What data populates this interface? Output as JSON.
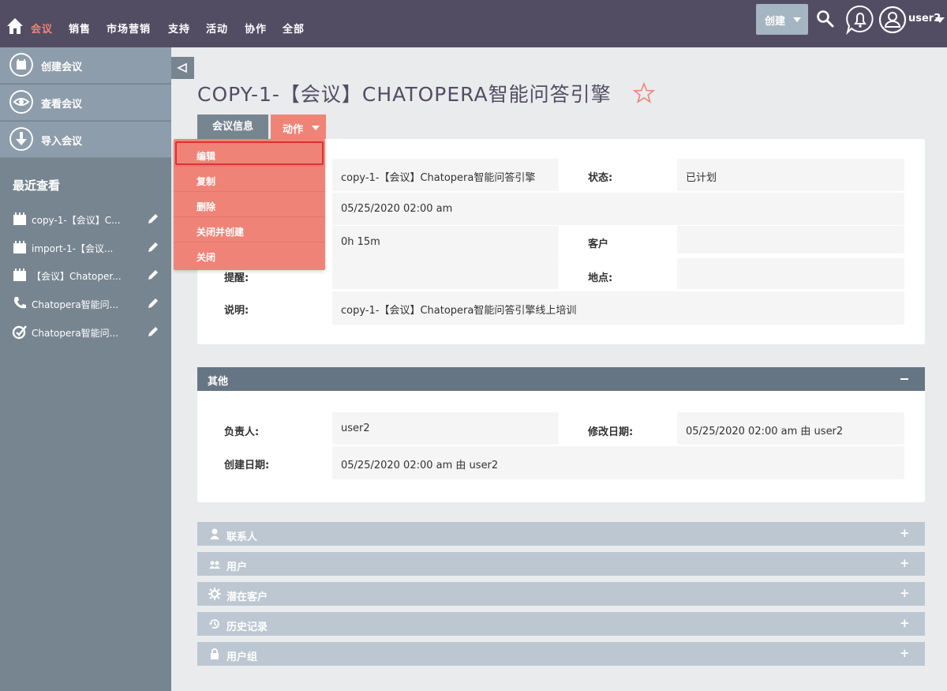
{
  "nav": {
    "items": [
      "会议",
      "销售",
      "市场营销",
      "支持",
      "活动",
      "协作",
      "全部"
    ],
    "create_label": "创建",
    "user_name": "user2"
  },
  "sidebar": {
    "actions": [
      "创建会议",
      "查看会议",
      "导入会议"
    ],
    "recent_title": "最近查看",
    "recent": [
      {
        "label": "copy-1-【会议】C...",
        "icon": "calendar-icon"
      },
      {
        "label": "import-1-【会议...",
        "icon": "calendar-icon"
      },
      {
        "label": "【会议】Chatoper...",
        "icon": "calendar-icon"
      },
      {
        "label": "Chatopera智能问...",
        "icon": "phone-icon"
      },
      {
        "label": "Chatopera智能问...",
        "icon": "task-check-icon"
      }
    ]
  },
  "page": {
    "title": "COPY-1-【会议】CHATOPERA智能问答引擎",
    "tab_info": "会议信息",
    "tab_actions": "动作"
  },
  "dropdown": {
    "items": [
      "编辑",
      "复制",
      "删除",
      "关闭并创建",
      "关闭"
    ]
  },
  "details": {
    "name_value": "copy-1-【会议】Chatopera智能问答引擎",
    "status_label": "状态:",
    "status_value": "已计划",
    "date_value": "05/25/2020 02:00 am",
    "duration_value": "0h 15m",
    "account_label": "客户",
    "account_value": "",
    "reminder_label": "提醒:",
    "reminder_value": "",
    "location_label": "地点:",
    "location_value": "",
    "description_label": "说明:",
    "description_value": "copy-1-【会议】Chatopera智能问答引擎线上培训"
  },
  "other": {
    "header": "其他",
    "assigned_label": "负责人:",
    "assigned_value": "user2",
    "modified_label": "修改日期:",
    "modified_value": "05/25/2020 02:00 am 由 user2",
    "created_label": "创建日期:",
    "created_value": "05/25/2020 02:00 am 由 user2"
  },
  "subpanels": [
    "联系人",
    "用户",
    "潜在客户",
    "历史记录",
    "用户组"
  ],
  "colors": {
    "nav_bg": "#534d64",
    "accent": "#f08377",
    "sidebar_bg": "#778591",
    "subpanel_bg": "#bcc7d1"
  }
}
